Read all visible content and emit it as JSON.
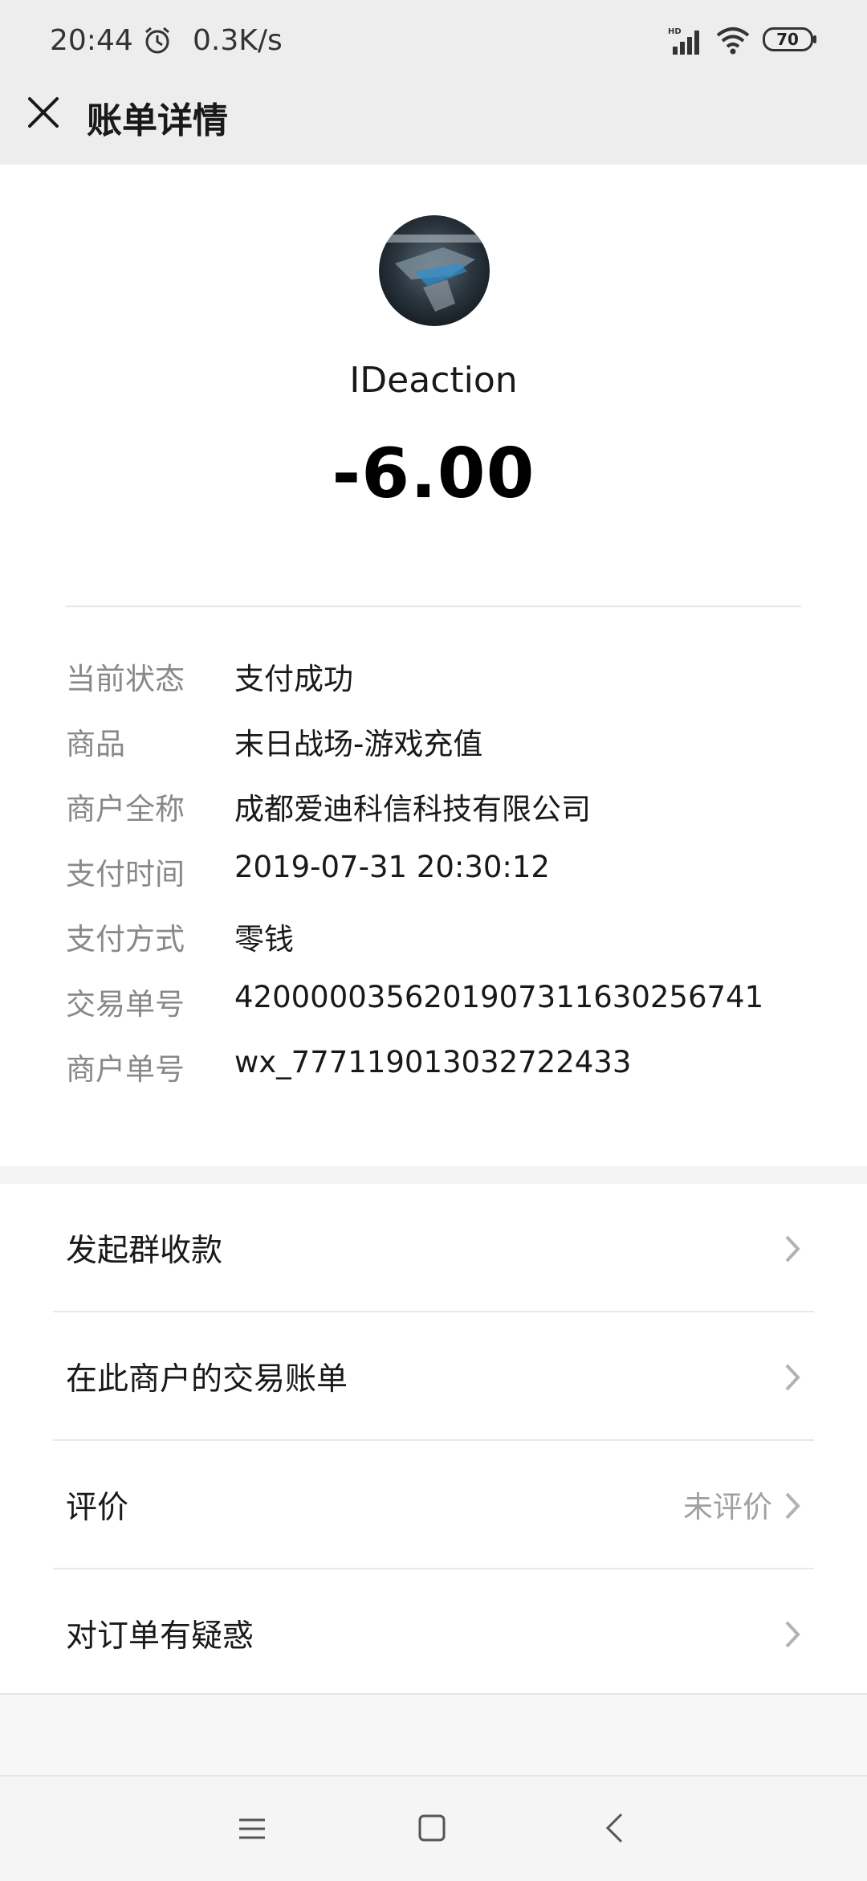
{
  "status_bar": {
    "time": "20:44",
    "net_speed": "0.3K/s",
    "battery": "70",
    "icons": [
      "alarm-icon",
      "signal-icon",
      "wifi-icon",
      "battery-icon"
    ]
  },
  "header": {
    "title": "账单详情",
    "close_icon": "close-icon"
  },
  "merchant": {
    "name": "IDeaction",
    "amount": "-6.00"
  },
  "details": [
    {
      "label": "当前状态",
      "value": "支付成功"
    },
    {
      "label": "商品",
      "value": "末日战场-游戏充值"
    },
    {
      "label": "商户全称",
      "value": "成都爱迪科信科技有限公司"
    },
    {
      "label": "支付时间",
      "value": "2019-07-31 20:30:12"
    },
    {
      "label": "支付方式",
      "value": "零钱"
    },
    {
      "label": "交易单号",
      "value": "4200000356201907311630256741"
    },
    {
      "label": "商户单号",
      "value": "wx_777119013032722433"
    }
  ],
  "actions": [
    {
      "label": "发起群收款",
      "extra": ""
    },
    {
      "label": "在此商户的交易账单",
      "extra": ""
    },
    {
      "label": "评价",
      "extra": "未评价"
    },
    {
      "label": "对订单有疑惑",
      "extra": ""
    }
  ],
  "colors": {
    "header_bg": "#ededed",
    "label_gray": "#888888",
    "text": "#191919"
  }
}
